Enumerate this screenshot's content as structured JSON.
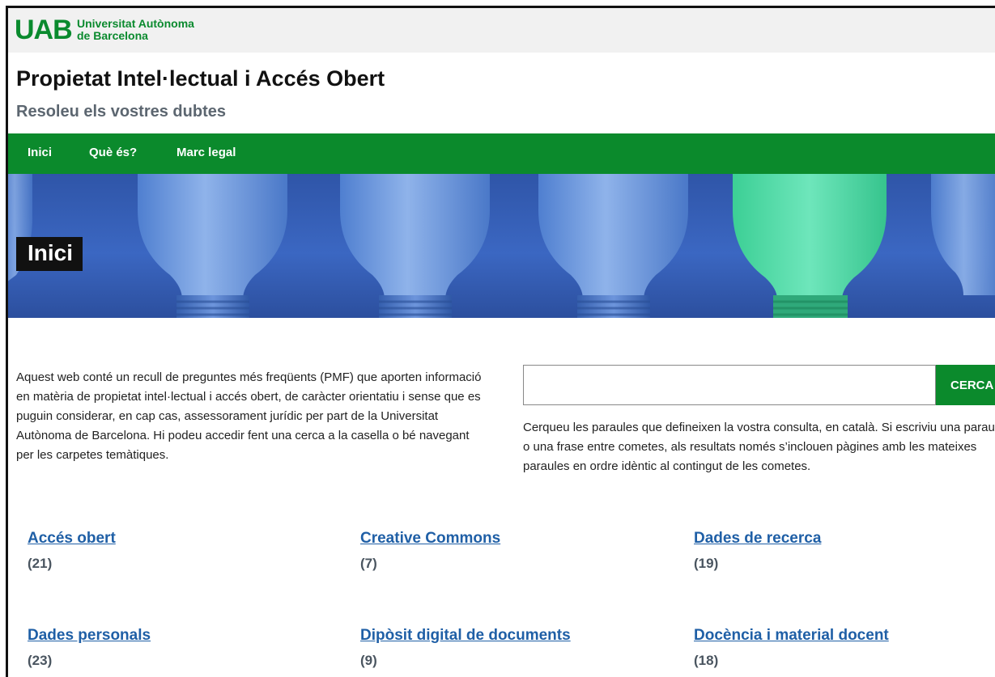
{
  "header": {
    "logo_mark": "UAB",
    "logo_line1": "Universitat Autònoma",
    "logo_line2": "de Barcelona",
    "site_title": "Propietat Intel·lectual i Accés Obert",
    "site_subtitle": "Resoleu els vostres dubtes"
  },
  "nav": {
    "items": [
      {
        "label": "Inici"
      },
      {
        "label": "Què és?"
      },
      {
        "label": "Marc legal"
      }
    ]
  },
  "hero": {
    "title": "Inici"
  },
  "intro": {
    "text": "Aquest web conté un recull de preguntes més freqüents (PMF) que aporten informació en matèria de propietat intel·lectual i accés obert, de caràcter orientatiu i sense que es puguin considerar, en cap cas, assessorament jurídic per part de la Universitat Autònoma de Barcelona. Hi podeu accedir fent una cerca a la casella o bé navegant per les carpetes temàtiques."
  },
  "search": {
    "value": "",
    "button_label": "CERCA",
    "help": "Cerqueu les paraules que defineixen la vostra consulta, en català. Si escriviu una paraula o una frase entre cometes, als resultats només s’inclouen pàgines amb les mateixes paraules en ordre idèntic al contingut de les cometes."
  },
  "categories": [
    {
      "label": "Accés obert",
      "count": "(21)"
    },
    {
      "label": "Creative Commons",
      "count": "(7)"
    },
    {
      "label": "Dades de recerca",
      "count": "(19)"
    },
    {
      "label": "Dades personals",
      "count": "(23)"
    },
    {
      "label": "Dipòsit digital de documents",
      "count": "(9)"
    },
    {
      "label": "Docència i material docent",
      "count": "(18)"
    }
  ],
  "colors": {
    "brand_green": "#0b8a2c",
    "link_blue": "#1f5fa6",
    "hero_blue": "#3b67c2",
    "highlight_bulb": "#4fd6a4"
  }
}
